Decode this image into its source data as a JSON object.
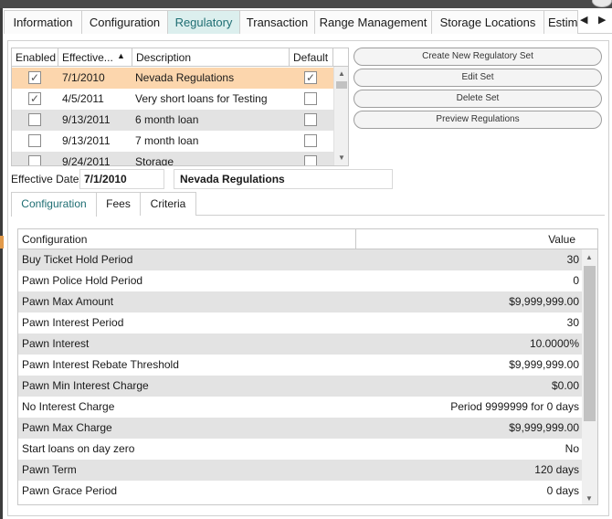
{
  "tabs": [
    {
      "label": "Information",
      "active": false
    },
    {
      "label": "Configuration",
      "active": false
    },
    {
      "label": "Regulatory",
      "active": true
    },
    {
      "label": "Transaction",
      "active": false
    },
    {
      "label": "Range Management",
      "active": false
    },
    {
      "label": "Storage Locations",
      "active": false
    },
    {
      "label": "Estim",
      "active": false
    }
  ],
  "tab_nav": {
    "prev": "◀",
    "next": "▶"
  },
  "sets_grid": {
    "columns": {
      "enabled": "Enabled",
      "effective": "Effective...",
      "description": "Description",
      "default": "Default"
    },
    "sort_indicator": "▲",
    "rows": [
      {
        "enabled": true,
        "effective": "7/1/2010",
        "description": "Nevada Regulations",
        "default": true
      },
      {
        "enabled": true,
        "effective": "4/5/2011",
        "description": "Very short loans for Testing",
        "default": false
      },
      {
        "enabled": false,
        "effective": "9/13/2011",
        "description": "6 month loan",
        "default": false
      },
      {
        "enabled": false,
        "effective": "9/13/2011",
        "description": "7 month loan",
        "default": false
      },
      {
        "enabled": false,
        "effective": "9/24/2011",
        "description": "Storage",
        "default": false
      }
    ],
    "check_glyph": "✓",
    "scroll_up": "▲",
    "scroll_down": "▼"
  },
  "buttons": {
    "create": "Create New Regulatory Set",
    "edit": "Edit Set",
    "delete": "Delete Set",
    "preview": "Preview Regulations"
  },
  "effective": {
    "label": "Effective Date",
    "date": "7/1/2010",
    "description": "Nevada Regulations"
  },
  "subtabs": [
    {
      "label": "Configuration",
      "active": true
    },
    {
      "label": "Fees",
      "active": false
    },
    {
      "label": "Criteria",
      "active": false
    }
  ],
  "config_grid": {
    "columns": {
      "name": "Configuration",
      "value": "Value"
    },
    "rows": [
      {
        "name": "Buy Ticket Hold Period",
        "value": "30"
      },
      {
        "name": "Pawn Police Hold Period",
        "value": "0"
      },
      {
        "name": "Pawn Max Amount",
        "value": "$9,999,999.00"
      },
      {
        "name": "Pawn Interest Period",
        "value": "30"
      },
      {
        "name": "Pawn Interest",
        "value": "10.0000%"
      },
      {
        "name": "Pawn Interest Rebate Threshold",
        "value": "$9,999,999.00"
      },
      {
        "name": "Pawn Min Interest Charge",
        "value": "$0.00"
      },
      {
        "name": "No Interest Charge",
        "value": "Period 9999999 for 0 days"
      },
      {
        "name": "Pawn Max Charge",
        "value": "$9,999,999.00"
      },
      {
        "name": "Start loans on day zero",
        "value": "No"
      },
      {
        "name": "Pawn Term",
        "value": "120 days"
      },
      {
        "name": "Pawn Grace Period",
        "value": "0 days"
      }
    ],
    "scroll_up": "▲",
    "scroll_down": "▼"
  },
  "colors": {
    "active_tab_bg": "#dcefee",
    "active_tab_text": "#1f6e73",
    "selected_row": "#fcd6ad",
    "alt_row": "#e3e3e3"
  }
}
